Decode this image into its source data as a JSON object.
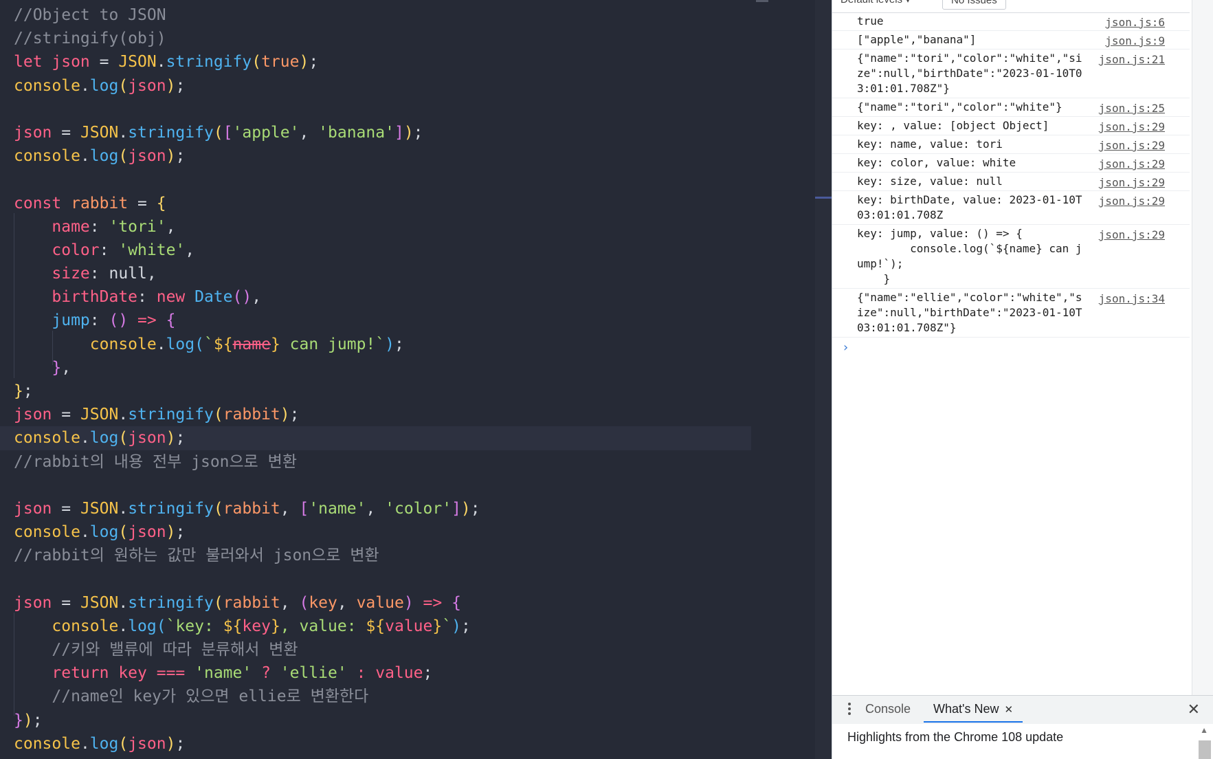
{
  "editor": {
    "lines": [
      {
        "t": [
          [
            "c",
            "//Object to JSON"
          ]
        ]
      },
      {
        "t": [
          [
            "c",
            "//stringify(obj)"
          ]
        ]
      },
      {
        "t": [
          [
            "kw",
            "let "
          ],
          [
            "rv",
            "json"
          ],
          [
            "tx",
            " = "
          ],
          [
            "ob",
            "JSON"
          ],
          [
            "tx",
            "."
          ],
          [
            "fn",
            "stringify"
          ],
          [
            "br1",
            "("
          ],
          [
            "pr",
            "true"
          ],
          [
            "br1",
            ")"
          ],
          [
            "tx",
            ";"
          ]
        ]
      },
      {
        "t": [
          [
            "ob",
            "console"
          ],
          [
            "tx",
            "."
          ],
          [
            "fn",
            "log"
          ],
          [
            "br1",
            "("
          ],
          [
            "rv",
            "json"
          ],
          [
            "br1",
            ")"
          ],
          [
            "tx",
            ";"
          ]
        ]
      },
      {
        "t": [
          [
            "tx",
            ""
          ]
        ]
      },
      {
        "t": [
          [
            "rv",
            "json"
          ],
          [
            "tx",
            " = "
          ],
          [
            "ob",
            "JSON"
          ],
          [
            "tx",
            "."
          ],
          [
            "fn",
            "stringify"
          ],
          [
            "br1",
            "("
          ],
          [
            "br2",
            "["
          ],
          [
            "st",
            "'apple'"
          ],
          [
            "tx",
            ", "
          ],
          [
            "st",
            "'banana'"
          ],
          [
            "br2",
            "]"
          ],
          [
            "br1",
            ")"
          ],
          [
            "tx",
            ";"
          ]
        ]
      },
      {
        "t": [
          [
            "ob",
            "console"
          ],
          [
            "tx",
            "."
          ],
          [
            "fn",
            "log"
          ],
          [
            "br1",
            "("
          ],
          [
            "rv",
            "json"
          ],
          [
            "br1",
            ")"
          ],
          [
            "tx",
            ";"
          ]
        ]
      },
      {
        "t": [
          [
            "tx",
            ""
          ]
        ]
      },
      {
        "t": [
          [
            "kw",
            "const "
          ],
          [
            "pr",
            "rabbit"
          ],
          [
            "tx",
            " = "
          ],
          [
            "br1",
            "{"
          ]
        ]
      },
      {
        "t": [
          [
            "tx",
            "    "
          ],
          [
            "rv",
            "name"
          ],
          [
            "tx",
            ": "
          ],
          [
            "st",
            "'tori'"
          ],
          [
            "tx",
            ","
          ]
        ]
      },
      {
        "t": [
          [
            "tx",
            "    "
          ],
          [
            "rv",
            "color"
          ],
          [
            "tx",
            ": "
          ],
          [
            "st",
            "'white'"
          ],
          [
            "tx",
            ","
          ]
        ]
      },
      {
        "t": [
          [
            "tx",
            "    "
          ],
          [
            "rv",
            "size"
          ],
          [
            "tx",
            ": "
          ],
          [
            "tx",
            "null,"
          ]
        ]
      },
      {
        "t": [
          [
            "tx",
            "    "
          ],
          [
            "rv",
            "birthDate"
          ],
          [
            "tx",
            ": "
          ],
          [
            "kw",
            "new "
          ],
          [
            "fn",
            "Date"
          ],
          [
            "br2",
            "()"
          ],
          [
            "tx",
            ","
          ]
        ]
      },
      {
        "t": [
          [
            "tx",
            "    "
          ],
          [
            "fn",
            "jump"
          ],
          [
            "tx",
            ": "
          ],
          [
            "br2",
            "()"
          ],
          [
            "kw",
            " => "
          ],
          [
            "br2",
            "{"
          ]
        ]
      },
      {
        "t": [
          [
            "tx",
            "        "
          ],
          [
            "ob",
            "console"
          ],
          [
            "tx",
            "."
          ],
          [
            "fn",
            "log"
          ],
          [
            "br3",
            "("
          ],
          [
            "st",
            "`"
          ],
          [
            "ob",
            "${"
          ],
          [
            "strike",
            "name"
          ],
          [
            "ob",
            "}"
          ],
          [
            "st",
            " can jump!`"
          ],
          [
            "br3",
            ")"
          ],
          [
            "tx",
            ";"
          ]
        ]
      },
      {
        "t": [
          [
            "tx",
            "    "
          ],
          [
            "br2",
            "}"
          ],
          [
            "tx",
            ","
          ]
        ]
      },
      {
        "t": [
          [
            "br1",
            "}"
          ],
          [
            "tx",
            ";"
          ]
        ]
      },
      {
        "t": [
          [
            "rv",
            "json"
          ],
          [
            "tx",
            " = "
          ],
          [
            "ob",
            "JSON"
          ],
          [
            "tx",
            "."
          ],
          [
            "fn",
            "stringify"
          ],
          [
            "br1",
            "("
          ],
          [
            "pr",
            "rabbit"
          ],
          [
            "br1",
            ")"
          ],
          [
            "tx",
            ";"
          ]
        ]
      },
      {
        "t": [
          [
            "ob",
            "console"
          ],
          [
            "tx",
            "."
          ],
          [
            "fn",
            "log"
          ],
          [
            "br1",
            "("
          ],
          [
            "rv",
            "json"
          ],
          [
            "br1",
            ")"
          ],
          [
            "tx",
            ";"
          ]
        ],
        "current": true
      },
      {
        "t": [
          [
            "c",
            "//rabbit의 내용 전부 json으로 변환"
          ]
        ]
      },
      {
        "t": [
          [
            "tx",
            ""
          ]
        ]
      },
      {
        "t": [
          [
            "rv",
            "json"
          ],
          [
            "tx",
            " = "
          ],
          [
            "ob",
            "JSON"
          ],
          [
            "tx",
            "."
          ],
          [
            "fn",
            "stringify"
          ],
          [
            "br1",
            "("
          ],
          [
            "pr",
            "rabbit"
          ],
          [
            "tx",
            ", "
          ],
          [
            "br2",
            "["
          ],
          [
            "st",
            "'name'"
          ],
          [
            "tx",
            ", "
          ],
          [
            "st",
            "'color'"
          ],
          [
            "br2",
            "]"
          ],
          [
            "br1",
            ")"
          ],
          [
            "tx",
            ";"
          ]
        ]
      },
      {
        "t": [
          [
            "ob",
            "console"
          ],
          [
            "tx",
            "."
          ],
          [
            "fn",
            "log"
          ],
          [
            "br1",
            "("
          ],
          [
            "rv",
            "json"
          ],
          [
            "br1",
            ")"
          ],
          [
            "tx",
            ";"
          ]
        ]
      },
      {
        "t": [
          [
            "c",
            "//rabbit의 원하는 값만 불러와서 json으로 변환"
          ]
        ]
      },
      {
        "t": [
          [
            "tx",
            ""
          ]
        ]
      },
      {
        "t": [
          [
            "rv",
            "json"
          ],
          [
            "tx",
            " = "
          ],
          [
            "ob",
            "JSON"
          ],
          [
            "tx",
            "."
          ],
          [
            "fn",
            "stringify"
          ],
          [
            "br1",
            "("
          ],
          [
            "pr",
            "rabbit"
          ],
          [
            "tx",
            ", "
          ],
          [
            "br2",
            "("
          ],
          [
            "pr",
            "key"
          ],
          [
            "tx",
            ", "
          ],
          [
            "pr",
            "value"
          ],
          [
            "br2",
            ")"
          ],
          [
            "kw",
            " => "
          ],
          [
            "br2",
            "{"
          ]
        ]
      },
      {
        "t": [
          [
            "tx",
            "    "
          ],
          [
            "ob",
            "console"
          ],
          [
            "tx",
            "."
          ],
          [
            "fn",
            "log"
          ],
          [
            "br3",
            "("
          ],
          [
            "st",
            "`key: "
          ],
          [
            "ob",
            "${"
          ],
          [
            "rv",
            "key"
          ],
          [
            "ob",
            "}"
          ],
          [
            "st",
            ", value: "
          ],
          [
            "ob",
            "${"
          ],
          [
            "rv",
            "value"
          ],
          [
            "ob",
            "}"
          ],
          [
            "st",
            "`"
          ],
          [
            "br3",
            ")"
          ],
          [
            "tx",
            ";"
          ]
        ]
      },
      {
        "t": [
          [
            "tx",
            "    "
          ],
          [
            "c",
            "//키와 밸류에 따라 분류해서 변환"
          ]
        ]
      },
      {
        "t": [
          [
            "tx",
            "    "
          ],
          [
            "kw",
            "return "
          ],
          [
            "rv",
            "key"
          ],
          [
            "kw",
            " === "
          ],
          [
            "st",
            "'name'"
          ],
          [
            "kw",
            " ? "
          ],
          [
            "st",
            "'ellie'"
          ],
          [
            "kw",
            " : "
          ],
          [
            "rv",
            "value"
          ],
          [
            "tx",
            ";"
          ]
        ]
      },
      {
        "t": [
          [
            "tx",
            "    "
          ],
          [
            "c",
            "//name인 key가 있으면 ellie로 변환한다"
          ]
        ]
      },
      {
        "t": [
          [
            "br2",
            "}"
          ],
          [
            "br1",
            ")"
          ],
          [
            "tx",
            ";"
          ]
        ]
      },
      {
        "t": [
          [
            "ob",
            "console"
          ],
          [
            "tx",
            "."
          ],
          [
            "fn",
            "log"
          ],
          [
            "br1",
            "("
          ],
          [
            "rv",
            "json"
          ],
          [
            "br1",
            ")"
          ],
          [
            "tx",
            ";"
          ]
        ]
      }
    ]
  },
  "devtools": {
    "toolbar": {
      "levels_label": "Default levels ▾",
      "issues_label": "No Issues"
    },
    "messages": [
      {
        "text": "true",
        "src": "json.js:6"
      },
      {
        "text": "[\"apple\",\"banana\"]",
        "src": "json.js:9"
      },
      {
        "text": "{\"name\":\"tori\",\"color\":\"white\",\"size\":null,\"birthDate\":\"2023-01-10T03:01:01.708Z\"}",
        "src": "json.js:21"
      },
      {
        "text": "{\"name\":\"tori\",\"color\":\"white\"}",
        "src": "json.js:25"
      },
      {
        "text": "key: , value: [object Object]",
        "src": "json.js:29"
      },
      {
        "text": "key: name, value: tori",
        "src": "json.js:29"
      },
      {
        "text": "key: color, value: white",
        "src": "json.js:29"
      },
      {
        "text": "key: size, value: null",
        "src": "json.js:29"
      },
      {
        "text": "key: birthDate, value: 2023-01-10T03:01:01.708Z",
        "src": "json.js:29"
      },
      {
        "text": "key: jump, value: () => {\n        console.log(`${name} can jump!`);\n    }",
        "src": "json.js:29"
      },
      {
        "text": "{\"name\":\"ellie\",\"color\":\"white\",\"size\":null,\"birthDate\":\"2023-01-10T03:01:01.708Z\"}",
        "src": "json.js:34"
      }
    ],
    "prompt_glyph": "›",
    "drawer": {
      "tabs": [
        {
          "label": "Console"
        },
        {
          "label": "What's New"
        }
      ],
      "close_glyph": "✕",
      "tab_close_glyph": "✕",
      "title": "Highlights from the Chrome 108 update"
    }
  }
}
